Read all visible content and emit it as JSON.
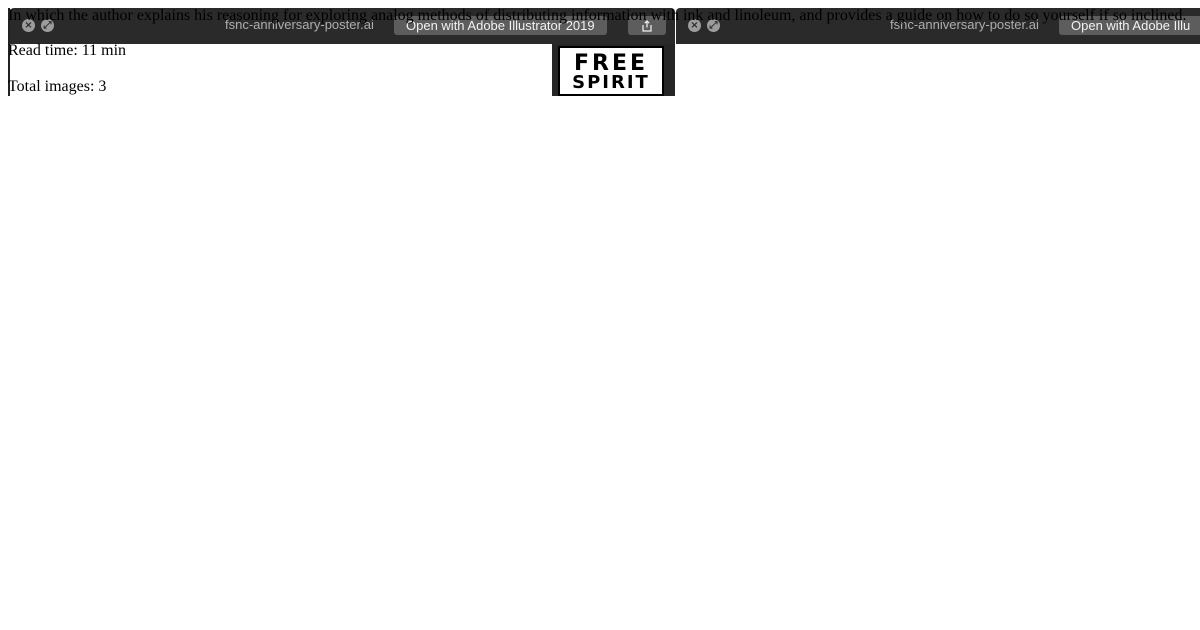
{
  "article": {
    "description": "In which the author explains his reasoning for exploring analog methods of distributing information with ink and linoleum, and provides a guide on how to do so yourself if so inclined.",
    "read_time": "Read time: 11 min",
    "total_images": "Total images: 3"
  },
  "quicklook_windows": [
    {
      "filename": "fsnc-anniversary-poster.ai",
      "open_button_label": "Open with Adobe Illustrator 2019",
      "close_icon": "close-icon",
      "fullscreen_icon": "fullscreen-icon",
      "share_icon": "share-icon",
      "poster_text": [
        "FREE",
        "SPIRIT"
      ]
    },
    {
      "filename": "fsnc-anniversary-poster.ai",
      "open_button_label": "Open with Adobe Illu",
      "close_icon": "close-icon",
      "fullscreen_icon": "fullscreen-icon"
    }
  ],
  "colors": {
    "toolbar_bg": "#2a2a2a",
    "button_bg": "#5d5d5d",
    "filename_text": "#aeaeae"
  }
}
